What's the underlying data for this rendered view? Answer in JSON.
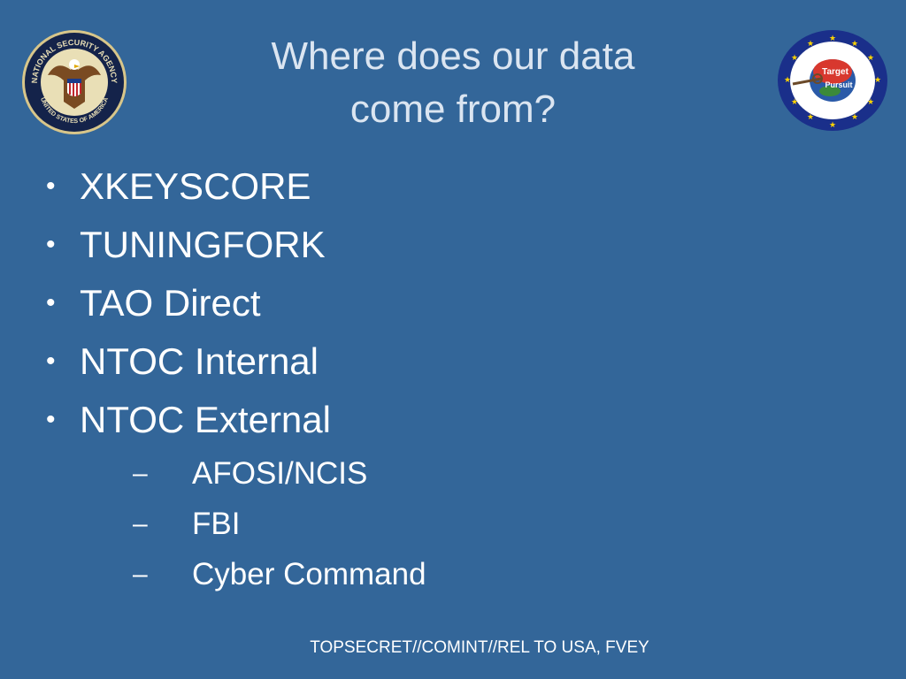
{
  "slide": {
    "title_line1": "Where does our data",
    "title_line2": "come from?",
    "bullets": [
      {
        "label": "XKEYSCORE"
      },
      {
        "label": "TUNINGFORK"
      },
      {
        "label": "TAO Direct"
      },
      {
        "label": "NTOC Internal"
      },
      {
        "label": "NTOC External"
      }
    ],
    "subbullets": [
      {
        "label": "AFOSI/NCIS"
      },
      {
        "label": "FBI"
      },
      {
        "label": "Cyber Command"
      }
    ],
    "bullet_glyph": "•",
    "subbullet_glyph": "–",
    "classification": "TOPSECRET//COMINT//REL TO USA, FVEY"
  },
  "logos": {
    "left": {
      "icon": "nsa-seal-icon",
      "text_top": "NATIONAL SECURITY AGENCY",
      "text_bottom": "UNITED STATES OF AMERICA"
    },
    "right": {
      "icon": "target-pursuit-logo-icon",
      "text": "Target Pursuit"
    }
  },
  "colors": {
    "background": "#336699",
    "title": "#dbe5f1",
    "text": "#ffffff"
  }
}
